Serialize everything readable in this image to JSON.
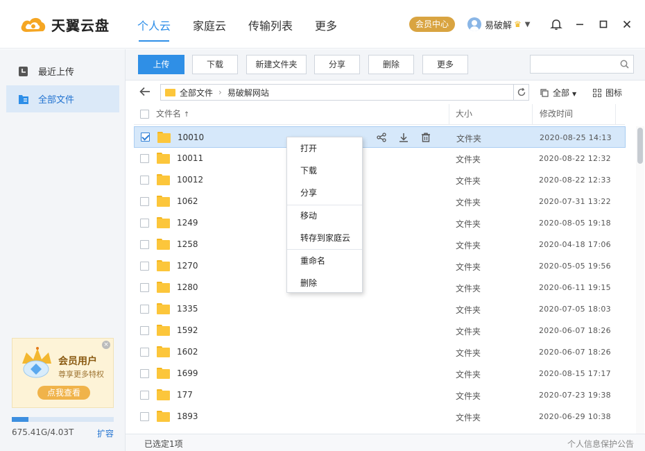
{
  "app": {
    "logo_text": "天翼云盘",
    "nav": [
      "个人云",
      "家庭云",
      "传输列表",
      "更多"
    ],
    "vip_label": "会员中心",
    "username": "易破解",
    "colors": {
      "accent": "#2d8ee8",
      "vip": "#d9a441",
      "folder": "#fcc63b",
      "selected_row": "#d6e8fa"
    }
  },
  "sidebar": {
    "items": [
      {
        "label": "最近上传",
        "icon": "clock-icon"
      },
      {
        "label": "全部文件",
        "icon": "folder-doc-icon"
      }
    ],
    "promo": {
      "title": "会员用户",
      "subtitle": "尊享更多特权",
      "button": "点我查看",
      "close": "×"
    },
    "quota": {
      "used_fraction": 0.164,
      "text": "675.41G/4.03T",
      "expand": "扩容"
    }
  },
  "toolbar": {
    "buttons": [
      "上传",
      "下载",
      "新建文件夹",
      "分享",
      "删除",
      "更多"
    ],
    "search_placeholder": ""
  },
  "path": {
    "root": "全部文件",
    "current": "易破解网站",
    "filter_label": "全部",
    "view_label": "图标"
  },
  "table": {
    "headers": {
      "name": "文件名",
      "sort_arrow": "↑",
      "size": "大小",
      "modified": "修改时间"
    },
    "rows": [
      {
        "name": "10010",
        "type": "文件夹",
        "time": "2020-08-25 14:13",
        "selected": true
      },
      {
        "name": "10011",
        "type": "文件夹",
        "time": "2020-08-22 12:32"
      },
      {
        "name": "10012",
        "type": "文件夹",
        "time": "2020-08-22 12:33"
      },
      {
        "name": "1062",
        "type": "文件夹",
        "time": "2020-07-31 13:22"
      },
      {
        "name": "1249",
        "type": "文件夹",
        "time": "2020-08-05 19:18"
      },
      {
        "name": "1258",
        "type": "文件夹",
        "time": "2020-04-18 17:06"
      },
      {
        "name": "1270",
        "type": "文件夹",
        "time": "2020-05-05 19:56"
      },
      {
        "name": "1280",
        "type": "文件夹",
        "time": "2020-06-11 19:15"
      },
      {
        "name": "1335",
        "type": "文件夹",
        "time": "2020-07-05 18:03"
      },
      {
        "name": "1592",
        "type": "文件夹",
        "time": "2020-06-07 18:26"
      },
      {
        "name": "1602",
        "type": "文件夹",
        "time": "2020-06-07 18:26"
      },
      {
        "name": "1699",
        "type": "文件夹",
        "time": "2020-08-15 17:17"
      },
      {
        "name": "177",
        "type": "文件夹",
        "time": "2020-07-23 19:38"
      },
      {
        "name": "1893",
        "type": "文件夹",
        "time": "2020-06-29 10:38"
      }
    ]
  },
  "context_menu": {
    "items": [
      "打开",
      "下载",
      "分享",
      "移动",
      "转存到家庭云",
      "重命名",
      "删除"
    ]
  },
  "status": {
    "selected_text": "已选定1项",
    "privacy_link": "个人信息保护公告"
  }
}
